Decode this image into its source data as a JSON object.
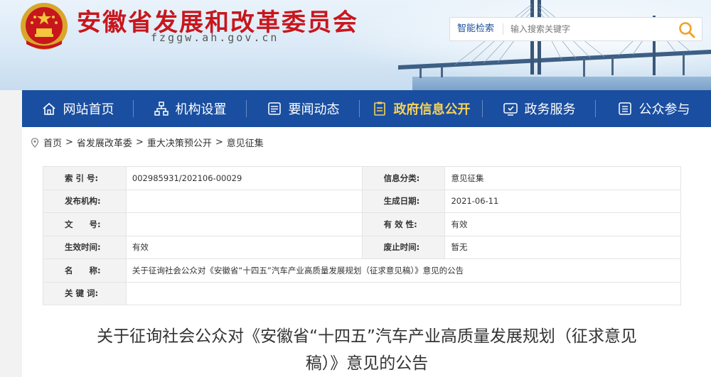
{
  "header": {
    "site_title": "安徽省发展和改革委员会",
    "site_domain": "fzggw.ah.gov.cn",
    "search_label": "智能检索",
    "search_placeholder": "输入搜索关键字"
  },
  "nav": {
    "items": [
      {
        "label": "网站首页",
        "icon": "home-icon",
        "active": false
      },
      {
        "label": "机构设置",
        "icon": "org-chart-icon",
        "active": false
      },
      {
        "label": "要闻动态",
        "icon": "news-icon",
        "active": false
      },
      {
        "label": "政府信息公开",
        "icon": "document-icon",
        "active": true
      },
      {
        "label": "政务服务",
        "icon": "service-icon",
        "active": false
      },
      {
        "label": "公众参与",
        "icon": "list-icon",
        "active": false
      }
    ],
    "active_color": "#f5d25a",
    "bg_color": "#1a4ea0"
  },
  "breadcrumb": [
    "首页",
    "省发展改革委",
    "重大决策预公开",
    "意见征集"
  ],
  "meta": {
    "index_no_label": "索 引 号:",
    "index_no": "002985931/202106-00029",
    "info_class_label": "信息分类:",
    "info_class": "意见征集",
    "publisher_label": "发布机构:",
    "publisher": "",
    "gen_date_label": "生成日期:",
    "gen_date": "2021-06-11",
    "doc_no_label": "文　　号:",
    "doc_no": "",
    "validity_label": "有 效 性:",
    "validity": "有效",
    "effective_label": "生效时间:",
    "effective": "有效",
    "abolish_label": "废止时间:",
    "abolish": "暂无",
    "name_label": "名　　称:",
    "name": "关于征询社会公众对《安徽省“十四五”汽车产业高质量发展规划（征求意见稿）》意见的公告",
    "keywords_label": "关 键 词:",
    "keywords": ""
  },
  "document": {
    "title_line1": "关于征询社会公众对《安徽省“十四五”汽车产业高质量发展规划（征求意见",
    "title_line2": "稿）》意见的公告"
  },
  "colors": {
    "title_red": "#c8161d",
    "brand_blue": "#1a4ea0"
  }
}
